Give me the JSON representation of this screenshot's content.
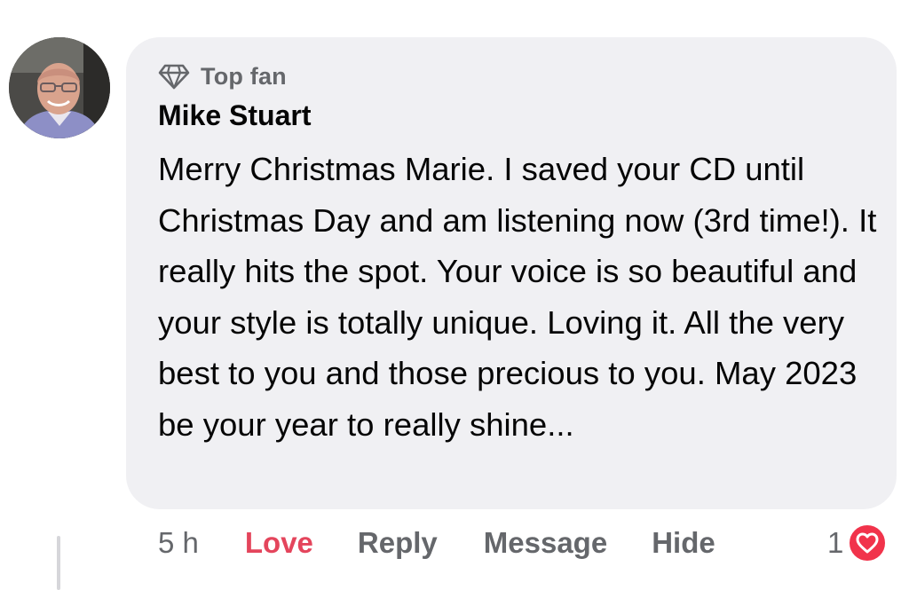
{
  "comment": {
    "badge": {
      "icon": "diamond-icon",
      "label": "Top fan"
    },
    "author": "Mike Stuart",
    "text": "Merry Christmas Marie. I saved your CD until Christmas Day and am listening now (3rd time!). It really hits the spot. Your voice is so beautiful and your style is totally unique. Loving it. All the very best to you and those precious to you. May 2023 be your year to really shine...",
    "actions": {
      "time": "5 h",
      "love": "Love",
      "reply": "Reply",
      "message": "Message",
      "hide": "Hide"
    },
    "reactions": {
      "count": "1",
      "icon": "heart-icon",
      "color": "#f1334b"
    }
  },
  "colors": {
    "bubble": "#f0f0f3",
    "secondary_text": "#65676b",
    "love_active": "#e4455c"
  }
}
